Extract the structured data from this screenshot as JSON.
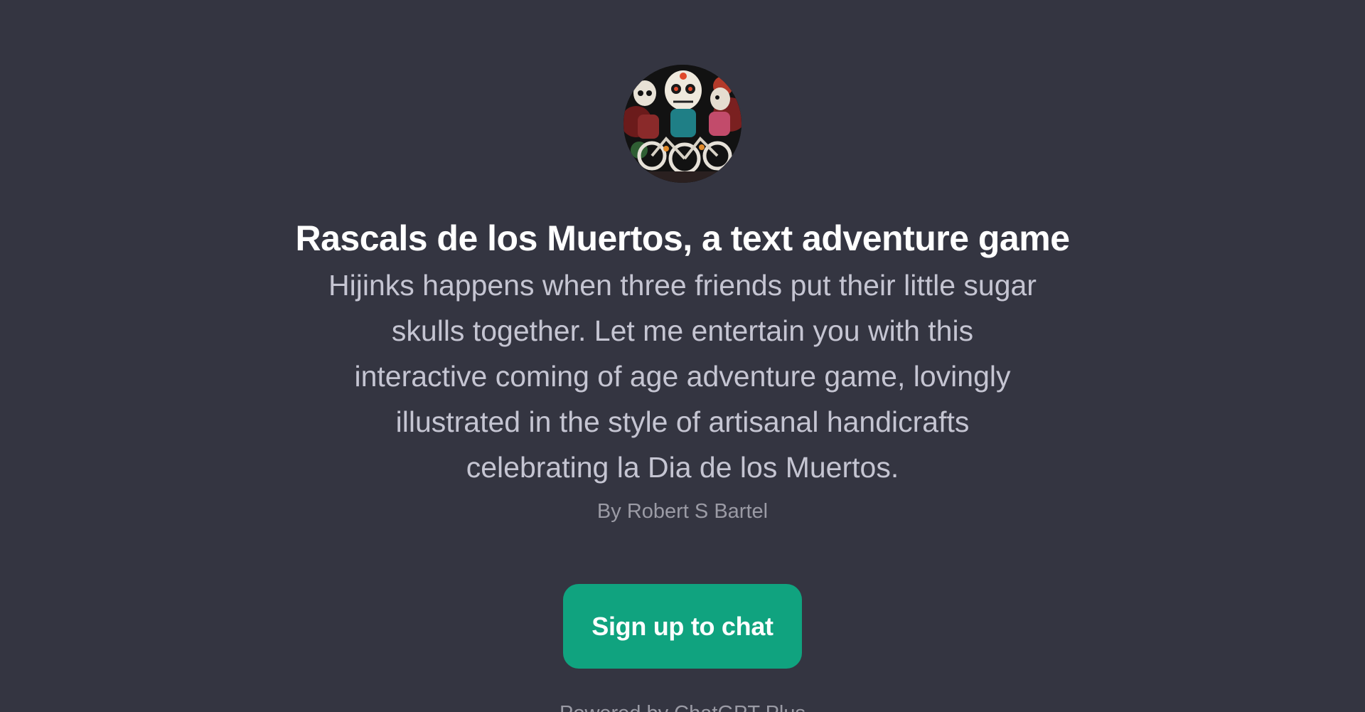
{
  "gpt": {
    "title": "Rascals de los Muertos, a text adventure game",
    "description": "Hijinks happens when three friends put their little sugar skulls together. Let me entertain you with this interactive coming of age adventure game, lovingly illustrated in the style of artisanal handicrafts celebrating la Dia de los Muertos.",
    "author": "By Robert S Bartel",
    "avatar_icon": "sugar-skull-bicycle-avatar"
  },
  "cta": {
    "signup_label": "Sign up to chat"
  },
  "footer": {
    "text": "Powered by ChatGPT Plus"
  },
  "colors": {
    "background": "#343541",
    "button": "#10a37f",
    "title": "#ffffff",
    "description": "#c5c5d2",
    "author": "#9b9ba5"
  }
}
